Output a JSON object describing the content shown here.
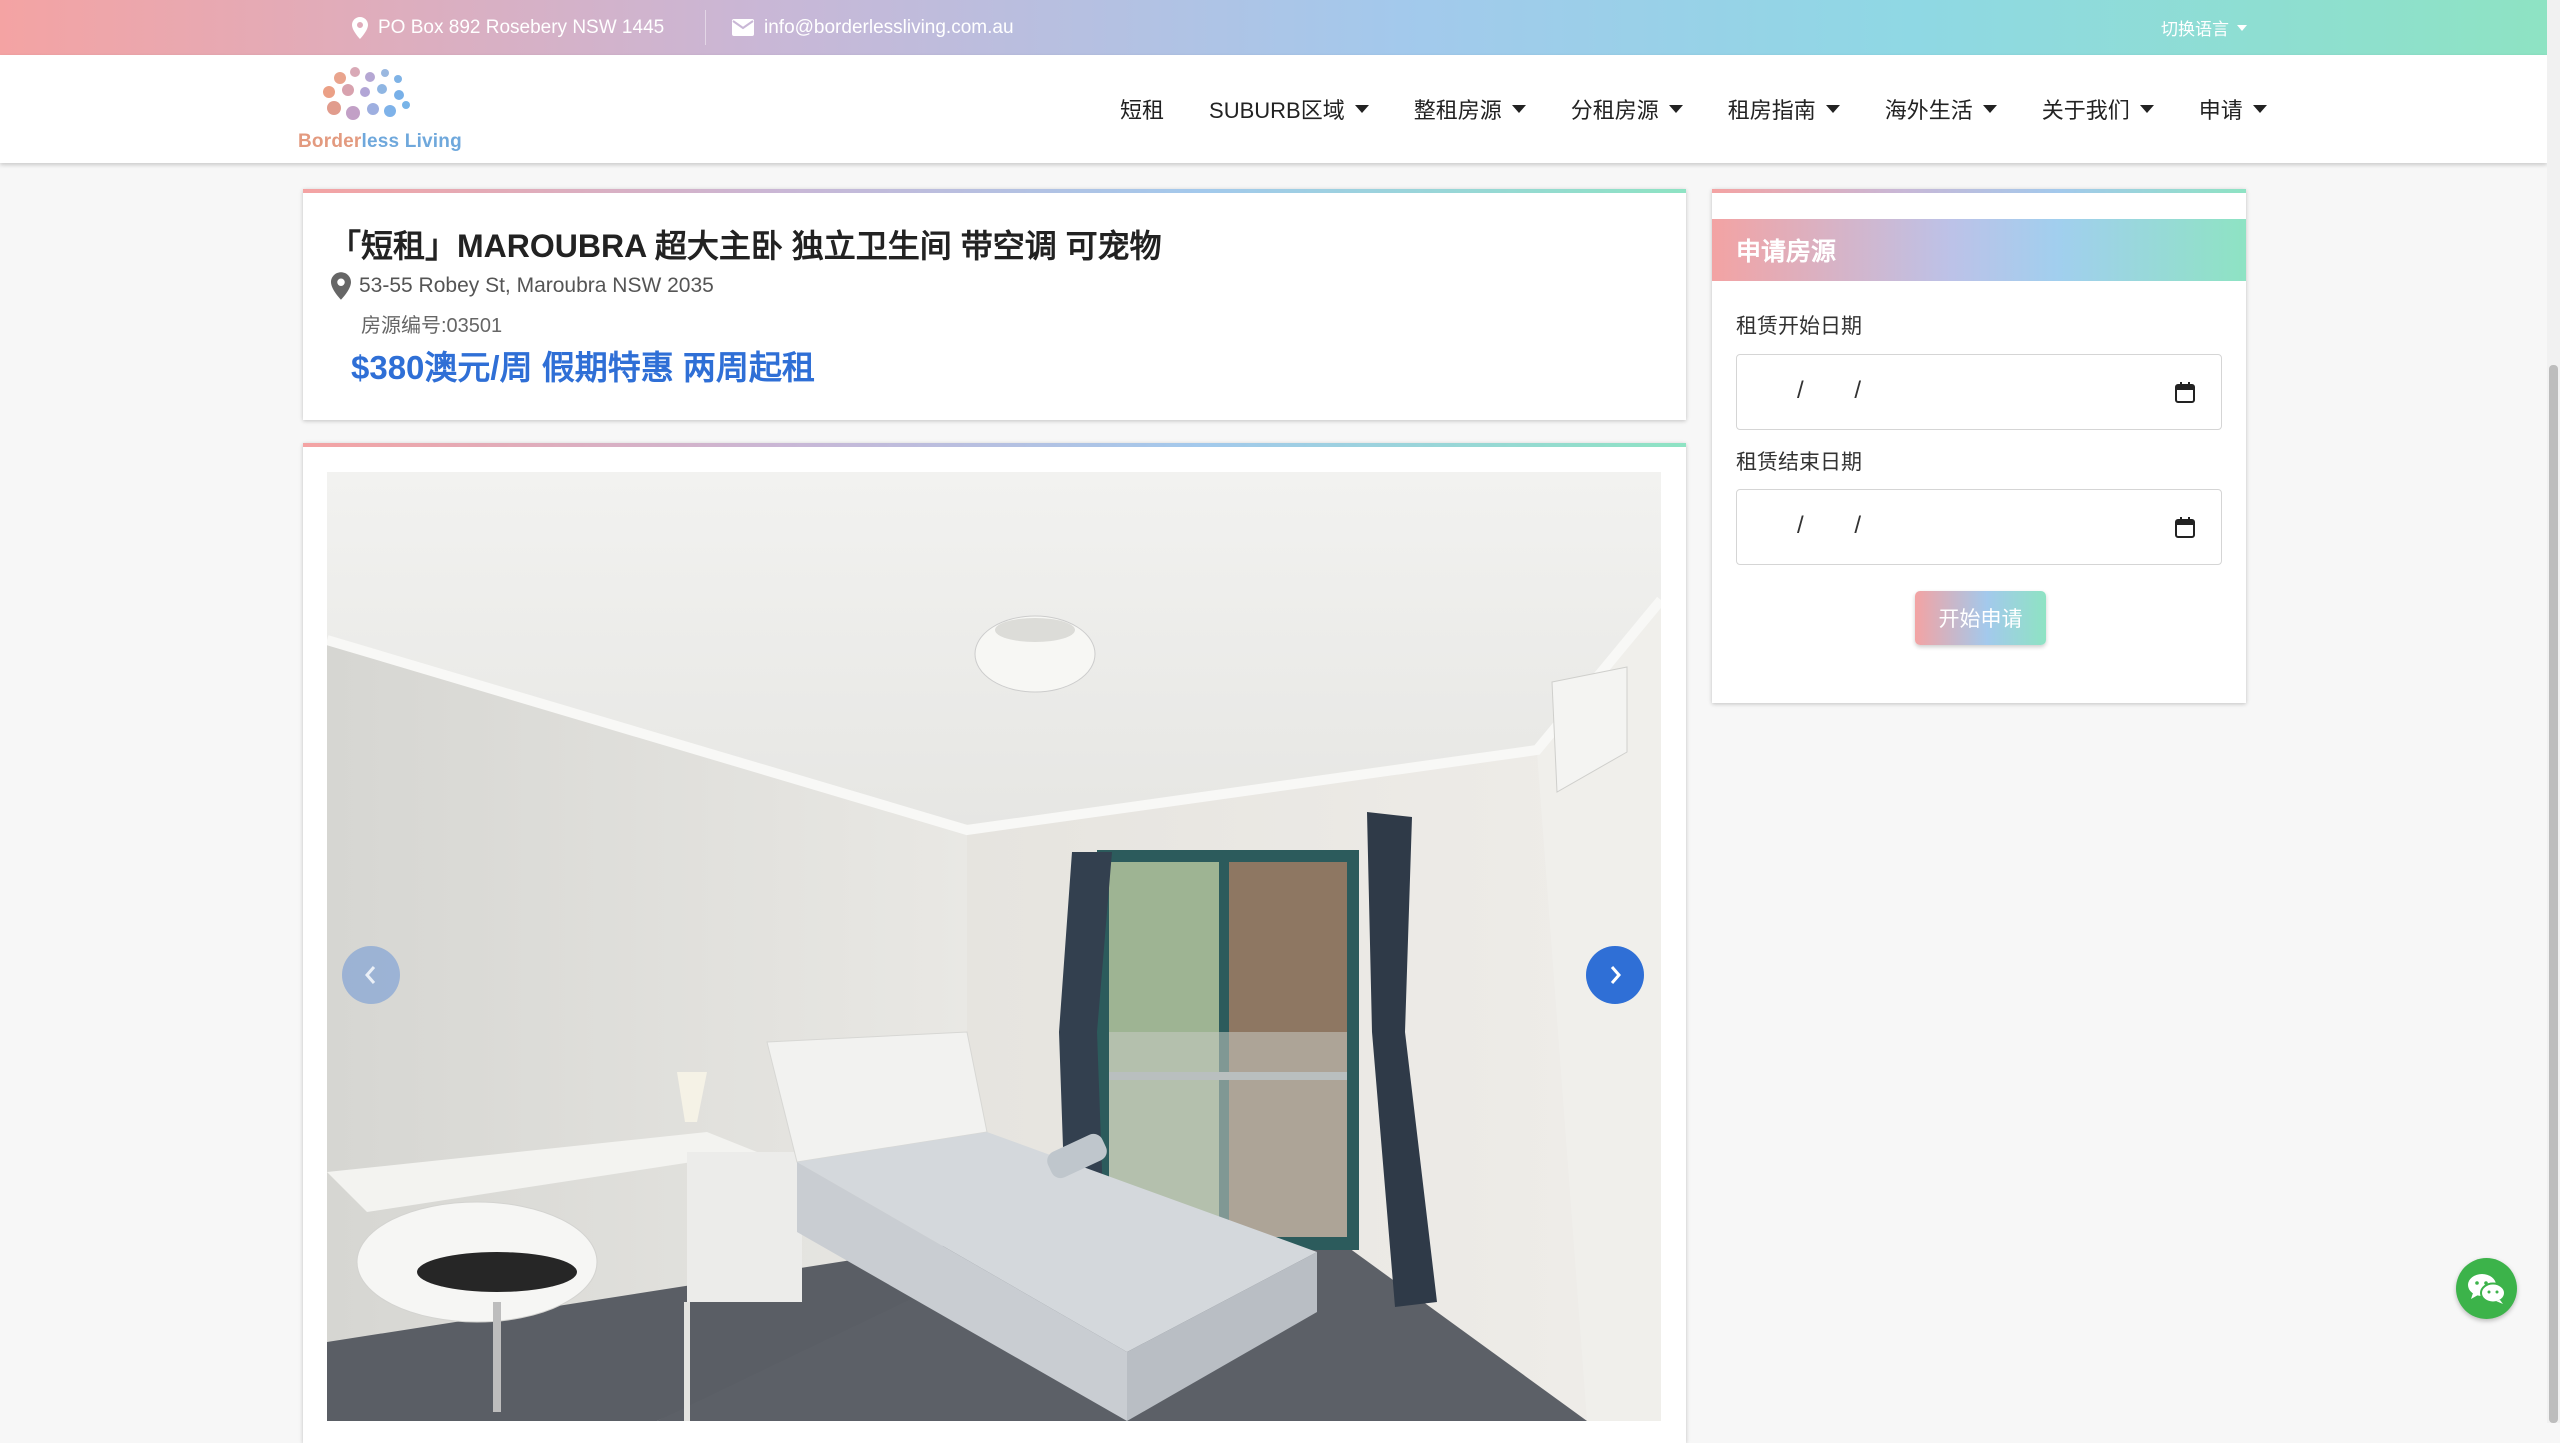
{
  "topbar": {
    "address": "PO Box 892 Rosebery NSW 1445",
    "email": "info@borderlessliving.com.au",
    "language": "切换语言"
  },
  "logo": {
    "part1": "Border",
    "part2": "less Living"
  },
  "nav": [
    {
      "label": "短租",
      "dropdown": false
    },
    {
      "label": "SUBURB区域",
      "dropdown": true
    },
    {
      "label": "整租房源",
      "dropdown": true
    },
    {
      "label": "分租房源",
      "dropdown": true
    },
    {
      "label": "租房指南",
      "dropdown": true
    },
    {
      "label": "海外生活",
      "dropdown": true
    },
    {
      "label": "关于我们",
      "dropdown": true
    },
    {
      "label": "申请",
      "dropdown": true
    }
  ],
  "listing": {
    "title": "「短租」MAROUBRA 超大主卧 独立卫生间 带空调 可宠物",
    "address": "53-55 Robey St, Maroubra NSW 2035",
    "property_id": "房源编号:03501",
    "price": "$380澳元/周 假期特惠 两周起租"
  },
  "sidebar": {
    "heading": "申请房源",
    "start_label": "租赁开始日期",
    "end_label": "租赁结束日期",
    "date_placeholder": "/ /",
    "apply_button": "开始申请"
  },
  "colors": {
    "accent_blue": "#2f6fd6",
    "wechat_green": "#3cb34a"
  }
}
